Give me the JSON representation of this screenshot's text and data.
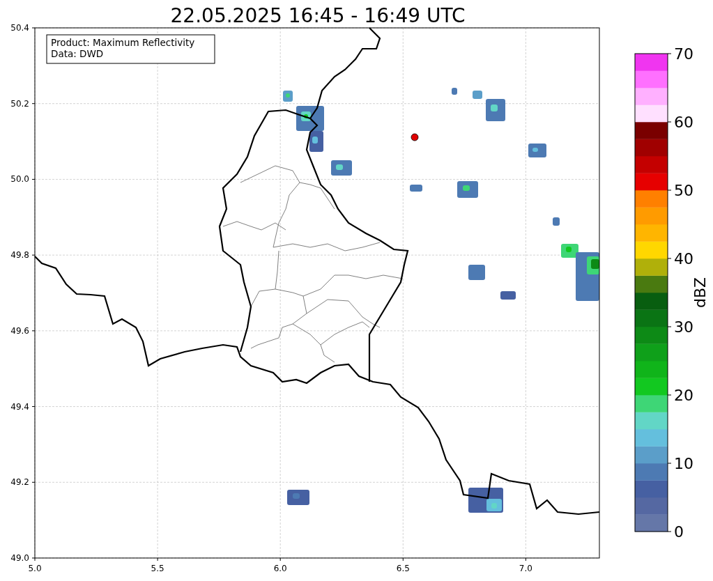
{
  "title": "22.05.2025 16:45 - 16:49 UTC",
  "legend": [
    "Product: Maximum Reflectivity",
    "Data: DWD"
  ],
  "map": {
    "xticks": [
      "5.0",
      "5.5",
      "6.0",
      "6.5",
      "7.0"
    ],
    "yticks": [
      "50.4",
      "50.2",
      "50.0",
      "49.8",
      "49.6",
      "49.4",
      "49.2",
      "49.0"
    ]
  },
  "colorbar": {
    "label": "dBZ",
    "ticks": [
      "70",
      "60",
      "50",
      "40",
      "30",
      "20",
      "10",
      "0"
    ],
    "segments": [
      {
        "color": "#6577a8"
      },
      {
        "color": "#5568a2"
      },
      {
        "color": "#4660a2"
      },
      {
        "color": "#4d7ab3"
      },
      {
        "color": "#5b9ec9"
      },
      {
        "color": "#64bfdd"
      },
      {
        "color": "#62d6c6"
      },
      {
        "color": "#3ed676"
      },
      {
        "color": "#12c820"
      },
      {
        "color": "#10b41a"
      },
      {
        "color": "#0fa01a"
      },
      {
        "color": "#0d8a16"
      },
      {
        "color": "#0a7414"
      },
      {
        "color": "#085e10"
      },
      {
        "color": "#4a7a10"
      },
      {
        "color": "#b0b00a"
      },
      {
        "color": "#ffd700"
      },
      {
        "color": "#ffb500"
      },
      {
        "color": "#ff9b00"
      },
      {
        "color": "#ff8000"
      },
      {
        "color": "#e60000"
      },
      {
        "color": "#c40000"
      },
      {
        "color": "#a00000"
      },
      {
        "color": "#7a0000"
      },
      {
        "color": "#ffe0ff"
      },
      {
        "color": "#ffb0ff"
      },
      {
        "color": "#ff70ff"
      },
      {
        "color": "#f035f0"
      }
    ]
  }
}
